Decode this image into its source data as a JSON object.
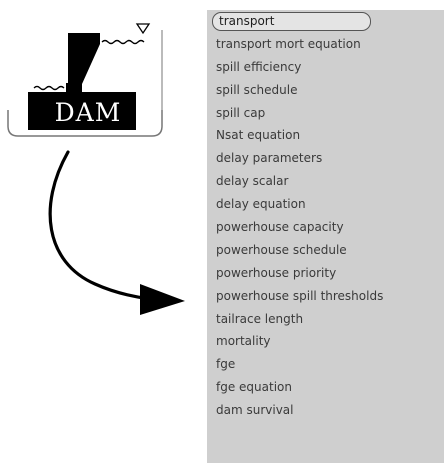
{
  "dam_icon": {
    "label": "DAM"
  },
  "menu": {
    "items": [
      {
        "label": "transport",
        "selected": true
      },
      {
        "label": "transport mort equation"
      },
      {
        "label": "spill efficiency"
      },
      {
        "label": "spill schedule"
      },
      {
        "label": "spill cap"
      },
      {
        "label": "Nsat equation"
      },
      {
        "label": "delay parameters"
      },
      {
        "label": "delay scalar"
      },
      {
        "label": "delay equation"
      },
      {
        "label": "powerhouse capacity"
      },
      {
        "label": "powerhouse schedule"
      },
      {
        "label": "powerhouse priority"
      },
      {
        "label": "powerhouse spill thresholds"
      },
      {
        "label": "tailrace length"
      },
      {
        "label": "mortality"
      },
      {
        "label": "fge"
      },
      {
        "label": "fge equation"
      },
      {
        "label": "dam survival"
      }
    ]
  },
  "colors": {
    "menu_background": "#cfcfcf",
    "menu_text": "#3a3a3a",
    "icon_fill": "#000000"
  }
}
